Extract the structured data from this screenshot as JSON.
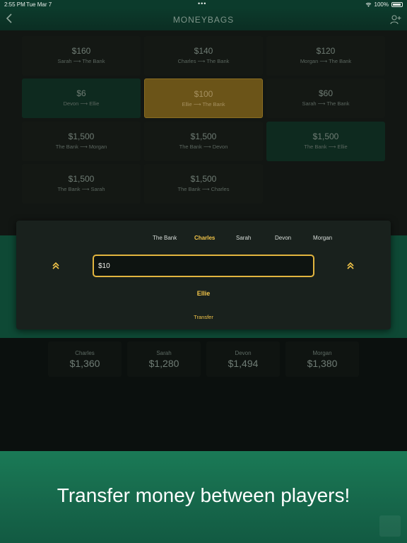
{
  "status_bar": {
    "time": "2:55 PM",
    "date": "Tue Mar 7",
    "battery": "100%"
  },
  "nav": {
    "title": "MONEYBAGS",
    "back_icon": "chevron-left-icon",
    "add_player_icon": "add-player-icon"
  },
  "transactions": [
    {
      "amount": "$160",
      "from": "Sarah",
      "to": "The Bank",
      "highlight": "none"
    },
    {
      "amount": "$140",
      "from": "Charles",
      "to": "The Bank",
      "highlight": "none"
    },
    {
      "amount": "$120",
      "from": "Morgan",
      "to": "The Bank",
      "highlight": "none"
    },
    {
      "amount": "$6",
      "from": "Devon",
      "to": "Ellie",
      "highlight": "green"
    },
    {
      "amount": "$100",
      "from": "Ellie",
      "to": "The Bank",
      "highlight": "gold"
    },
    {
      "amount": "$60",
      "from": "Sarah",
      "to": "The Bank",
      "highlight": "none"
    },
    {
      "amount": "$1,500",
      "from": "The Bank",
      "to": "Morgan",
      "highlight": "none"
    },
    {
      "amount": "$1,500",
      "from": "The Bank",
      "to": "Devon",
      "highlight": "none"
    },
    {
      "amount": "$1,500",
      "from": "The Bank",
      "to": "Ellie",
      "highlight": "green"
    },
    {
      "amount": "$1,500",
      "from": "The Bank",
      "to": "Sarah",
      "highlight": "none"
    },
    {
      "amount": "$1,500",
      "from": "The Bank",
      "to": "Charles",
      "highlight": "none"
    }
  ],
  "arrow": "⟶",
  "transfer_panel": {
    "recipients": [
      "The Bank",
      "Charles",
      "Sarah",
      "Devon",
      "Morgan"
    ],
    "selected_recipient": "Charles",
    "amount_value": "$10",
    "sender": "Ellie",
    "transfer_label": "Transfer",
    "up_icon": "double-chevron-up-icon",
    "accent_color": "#f1c449"
  },
  "balances": [
    {
      "name": "Charles",
      "value": "$1,360"
    },
    {
      "name": "Sarah",
      "value": "$1,280"
    },
    {
      "name": "Devon",
      "value": "$1,494"
    },
    {
      "name": "Morgan",
      "value": "$1,380"
    }
  ],
  "promo": {
    "caption": "Transfer money between players!"
  }
}
